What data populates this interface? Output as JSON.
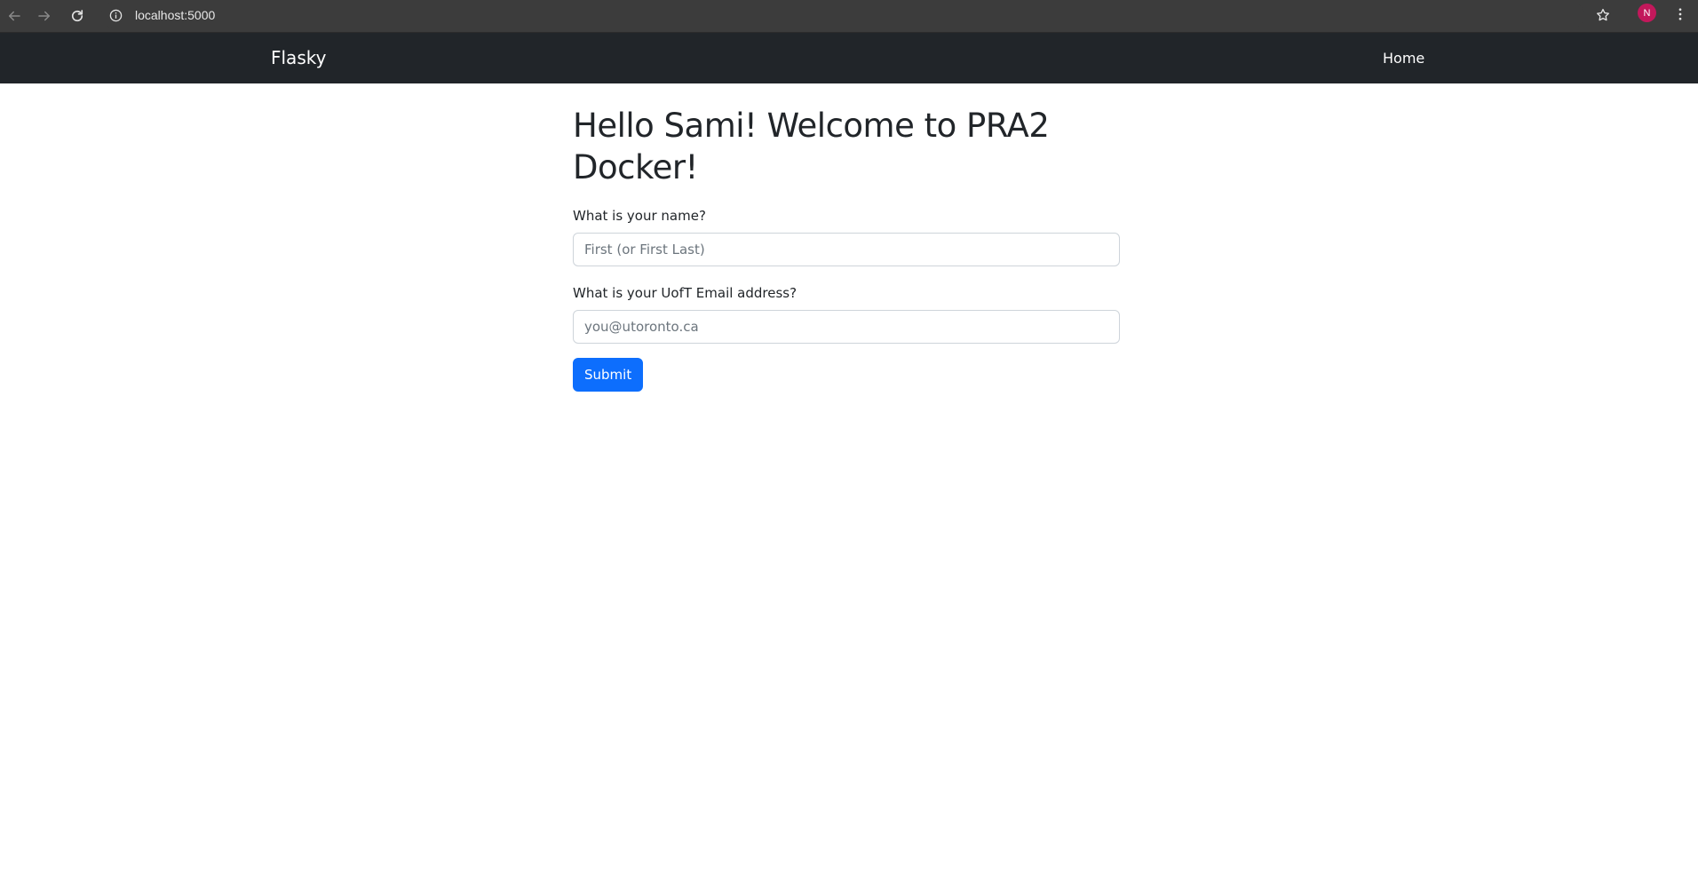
{
  "browser": {
    "url": "localhost:5000",
    "profile_initial": "N",
    "icons": {
      "back": "arrow-left-icon",
      "forward": "arrow-right-icon",
      "reload": "reload-icon",
      "site_info": "info-icon",
      "bookmark": "star-icon",
      "menu": "kebab-menu-icon"
    },
    "colors": {
      "chrome_bg": "#3c3c3c",
      "avatar_bg": "#c2185b"
    }
  },
  "navbar": {
    "brand": "Flasky",
    "links": [
      "Home"
    ],
    "bg_color": "#212529"
  },
  "main": {
    "title": "Hello Sami! Welcome to PRA2 Docker!",
    "form": {
      "name_label": "What is your name?",
      "name_placeholder": "First (or First Last)",
      "name_value": "",
      "email_label": "What is your UofT Email address?",
      "email_placeholder": "you@utoronto.ca",
      "email_value": "",
      "submit_label": "Submit",
      "submit_color": "#0d6efd"
    }
  }
}
